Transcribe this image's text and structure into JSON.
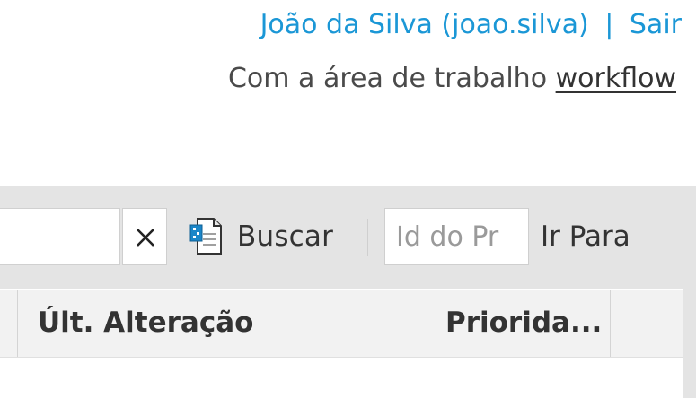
{
  "header": {
    "user_display": "João da Silva (joao.silva)",
    "separator": "|",
    "logout_label": "Sair",
    "workspace_prefix": "Com a área de trabalho",
    "workspace_name": "workflow"
  },
  "toolbar": {
    "search_value": "",
    "clear_icon": "close-icon",
    "search_icon": "document-search-icon",
    "search_label": "Buscar",
    "goto_placeholder": "Id do Pr",
    "goto_label": "Ir Para"
  },
  "table": {
    "columns": [
      {
        "label": "Últ. Alteração"
      },
      {
        "label": "Priorida..."
      }
    ]
  },
  "colors": {
    "link_blue": "#1b97d6",
    "toolbar_bg": "#e4e4e4",
    "header_bg": "#f2f2f2",
    "text": "#333333"
  }
}
